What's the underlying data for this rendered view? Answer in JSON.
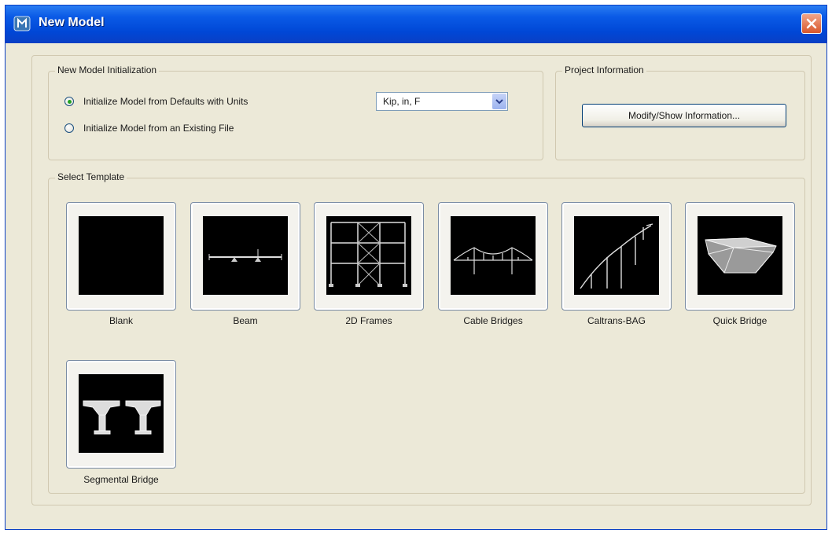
{
  "window": {
    "title": "New Model"
  },
  "initialization": {
    "group_label": "New Model Initialization",
    "option_defaults_label": "Initialize Model from Defaults with Units",
    "option_existing_label": "Initialize Model  from an Existing File",
    "selected_option": "defaults",
    "units_value": "Kip, in, F"
  },
  "project": {
    "group_label": "Project Information",
    "modify_button_label": "Modify/Show Information..."
  },
  "templates": {
    "group_label": "Select Template",
    "items": [
      {
        "label": "Blank"
      },
      {
        "label": "Beam"
      },
      {
        "label": "2D Frames"
      },
      {
        "label": "Cable Bridges"
      },
      {
        "label": "Caltrans-BAG"
      },
      {
        "label": "Quick Bridge"
      },
      {
        "label": "Segmental Bridge"
      }
    ]
  },
  "colors": {
    "title_bar": "#0a5ae6",
    "dialog_bg": "#ece9d8",
    "thumbnail_bg": "#000000",
    "selected_radio": "#21a121"
  }
}
